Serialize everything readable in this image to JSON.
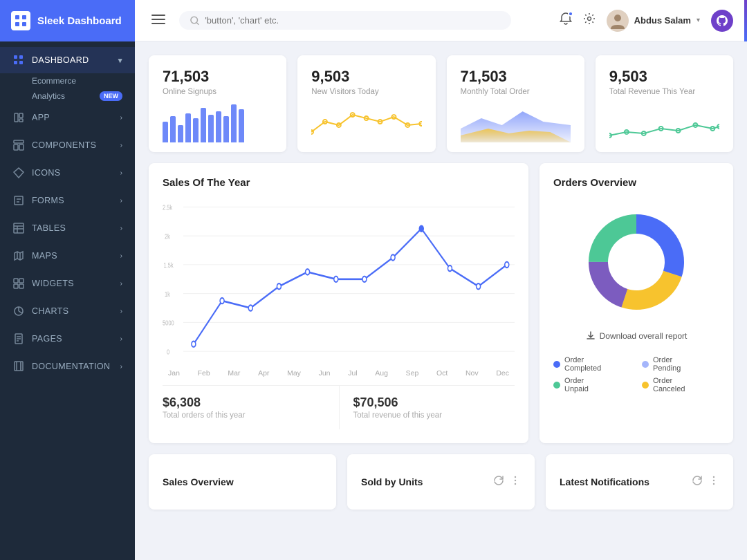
{
  "sidebar": {
    "brand": "Sleek Dashboard",
    "nav_items": [
      {
        "id": "dashboard",
        "label": "DASHBOARD",
        "icon": "grid",
        "active": true,
        "has_arrow": true
      },
      {
        "id": "ecommerce",
        "label": "Ecommerce",
        "sub": true
      },
      {
        "id": "analytics",
        "label": "Analytics",
        "sub": true,
        "badge": "NEW"
      },
      {
        "id": "app",
        "label": "APP",
        "icon": "app",
        "has_arrow": true
      },
      {
        "id": "components",
        "label": "COMPONENTS",
        "icon": "components",
        "has_arrow": true
      },
      {
        "id": "icons",
        "label": "ICONS",
        "icon": "diamond",
        "has_arrow": true
      },
      {
        "id": "forms",
        "label": "FORMS",
        "icon": "forms",
        "has_arrow": true
      },
      {
        "id": "tables",
        "label": "TABLES",
        "icon": "tables",
        "has_arrow": true
      },
      {
        "id": "maps",
        "label": "MAPS",
        "icon": "maps",
        "has_arrow": true
      },
      {
        "id": "widgets",
        "label": "WIDGETS",
        "icon": "widgets",
        "has_arrow": true
      },
      {
        "id": "charts",
        "label": "CHARTS",
        "icon": "charts",
        "has_arrow": true
      },
      {
        "id": "pages",
        "label": "PAGES",
        "icon": "pages",
        "has_arrow": true
      },
      {
        "id": "documentation",
        "label": "DOCUMENTATION",
        "icon": "docs",
        "has_arrow": true
      }
    ]
  },
  "topbar": {
    "search_placeholder": "'button', 'chart' etc.",
    "user_name": "Abdus Salam"
  },
  "stats": [
    {
      "number": "71,503",
      "label": "Online Signups",
      "type": "bar"
    },
    {
      "number": "9,503",
      "label": "New Visitors Today",
      "type": "line_yellow"
    },
    {
      "number": "71,503",
      "label": "Monthly Total Order",
      "type": "mountain"
    },
    {
      "number": "9,503",
      "label": "Total Revenue This Year",
      "type": "line_green"
    }
  ],
  "sales_chart": {
    "title": "Sales Of The Year",
    "months": [
      "Jan",
      "Feb",
      "Mar",
      "Apr",
      "May",
      "Jun",
      "Jul",
      "Aug",
      "Sep",
      "Oct",
      "Nov",
      "Dec"
    ],
    "y_labels": [
      "2.5k",
      "2k",
      "1.5k",
      "1k",
      "5000",
      "0"
    ],
    "total_orders": "$6,308",
    "total_orders_label": "Total orders of this year",
    "total_revenue": "$70,506",
    "total_revenue_label": "Total revenue of this year"
  },
  "orders_overview": {
    "title": "Orders Overview",
    "download_label": "Download overall report",
    "legend": [
      {
        "label": "Order Completed",
        "color": "#4a6cf7"
      },
      {
        "label": "Order Pending",
        "color": "#4a6cf7"
      },
      {
        "label": "Order Unpaid",
        "color": "#4dc896"
      },
      {
        "label": "Order Canceled",
        "color": "#f7c32e"
      }
    ],
    "donut": {
      "segments": [
        {
          "value": 30,
          "color": "#4a6cf7"
        },
        {
          "value": 25,
          "color": "#f7c32e"
        },
        {
          "value": 20,
          "color": "#7c5cbf"
        },
        {
          "value": 25,
          "color": "#4dc896"
        }
      ]
    }
  },
  "bottom_cards": [
    {
      "title": "Sales Overview"
    },
    {
      "title": "Sold by Units"
    },
    {
      "title": "Latest Notifications"
    }
  ]
}
